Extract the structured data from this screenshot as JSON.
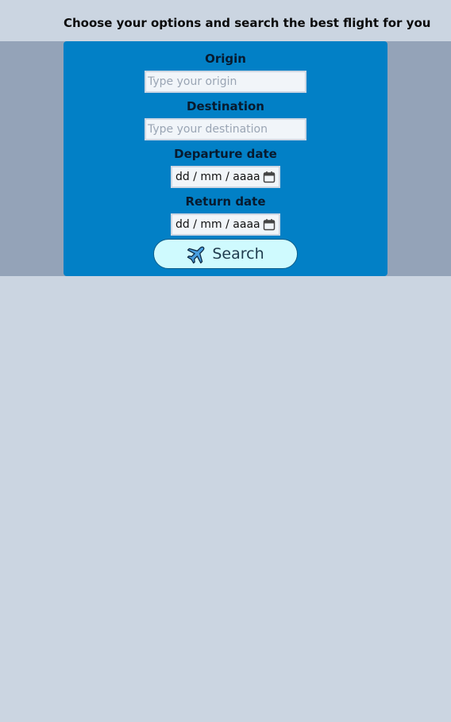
{
  "header": {
    "title": "Choose your options and search the best flight for you"
  },
  "form": {
    "origin": {
      "label": "Origin",
      "placeholder": "Type your origin",
      "value": ""
    },
    "destination": {
      "label": "Destination",
      "placeholder": "Type your destination",
      "value": ""
    },
    "departure": {
      "label": "Departure date",
      "mask": "dd / mm / aaaa",
      "icon": "calendar-icon"
    },
    "return": {
      "label": "Return date",
      "mask": "dd / mm / aaaa",
      "icon": "calendar-icon"
    },
    "search": {
      "label": "Search",
      "icon": "airplane-icon"
    }
  },
  "colors": {
    "page_background": "#cbd5e1",
    "band_background": "#94a3b8",
    "card_background": "#0280c6",
    "input_background": "#f1f5f9",
    "button_background": "#cffafe"
  }
}
